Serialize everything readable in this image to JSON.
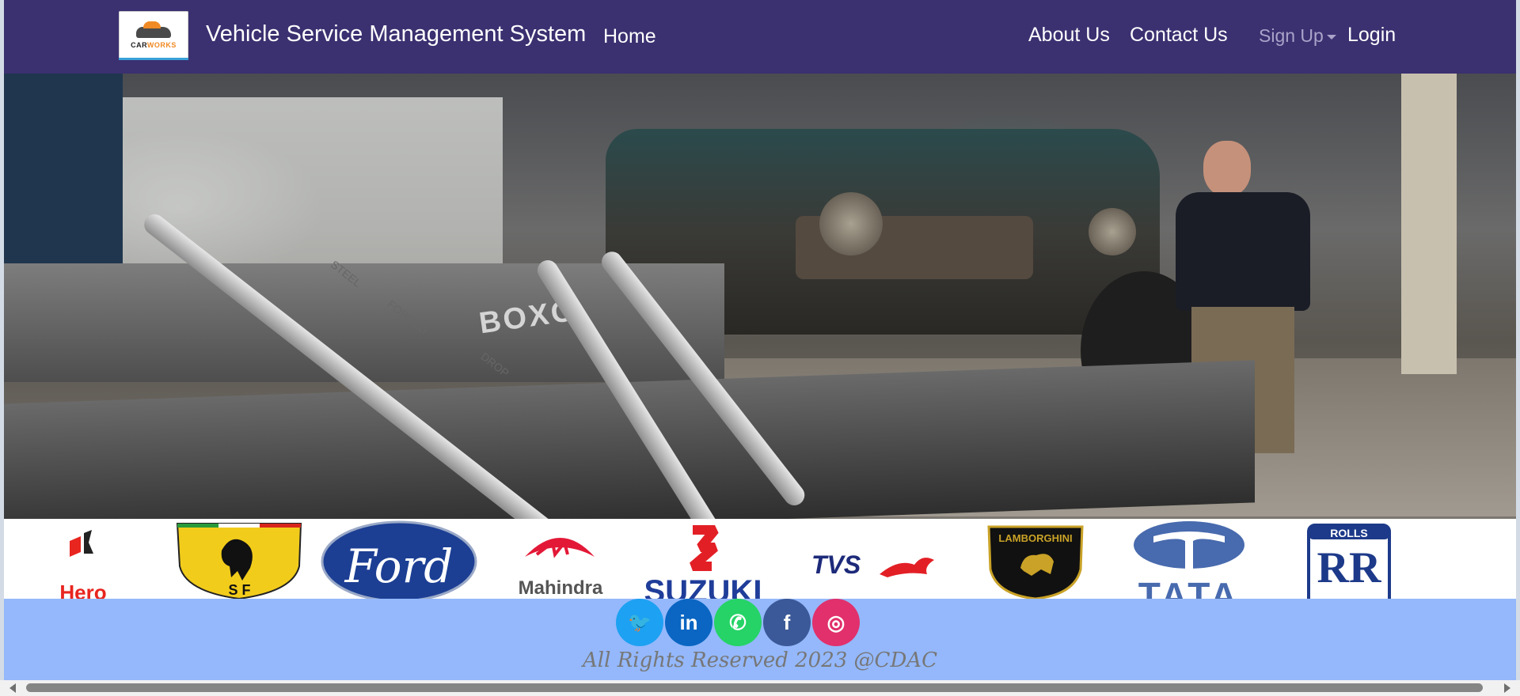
{
  "navbar": {
    "logo_text_1": "CAR",
    "logo_text_2": "WORKS",
    "title": "Vehicle Service Management System",
    "home": "Home",
    "about": "About Us",
    "contact": "Contact Us",
    "signup": "Sign Up",
    "login": "Login"
  },
  "hero": {
    "toolbox_brand": "BOXO",
    "wrench_label_1": "DROP",
    "wrench_label_2": "FORGED",
    "wrench_label_3": "STEEL"
  },
  "brands": {
    "items": [
      {
        "name": "Hero",
        "icon": "hero-logo",
        "color": "#e8251f"
      },
      {
        "name": "S F",
        "icon": "ferrari-logo",
        "color": "#f2cc1b"
      },
      {
        "name": "Ford",
        "icon": "ford-logo",
        "color": "#1c3f94"
      },
      {
        "name": "Mahindra",
        "icon": "mahindra-logo",
        "color": "#e31837"
      },
      {
        "name": "SUZUKI",
        "icon": "suzuki-logo",
        "color": "#1f3d99"
      },
      {
        "name": "TVS",
        "icon": "tvs-logo",
        "color": "#1d2a7a"
      },
      {
        "name": "LAMBORGHINI",
        "icon": "lamborghini-logo",
        "color": "#c9a227"
      },
      {
        "name": "TATA",
        "icon": "tata-logo",
        "color": "#486aae"
      },
      {
        "name": "ROLLS",
        "icon": "rolls-royce-logo",
        "color": "#1d3a8a"
      }
    ]
  },
  "footer": {
    "social": [
      {
        "icon": "twitter-icon",
        "glyph": "🐦",
        "color": "#1da1f2"
      },
      {
        "icon": "linkedin-icon",
        "glyph": "in",
        "color": "#0a66c2"
      },
      {
        "icon": "whatsapp-icon",
        "glyph": "✆",
        "color": "#25d366"
      },
      {
        "icon": "facebook-icon",
        "glyph": "f",
        "color": "#3b5998"
      },
      {
        "icon": "instagram-icon",
        "glyph": "◎",
        "color": "#e1306c"
      }
    ],
    "copyright": "All Rights Reserved 2023 @CDAC"
  }
}
